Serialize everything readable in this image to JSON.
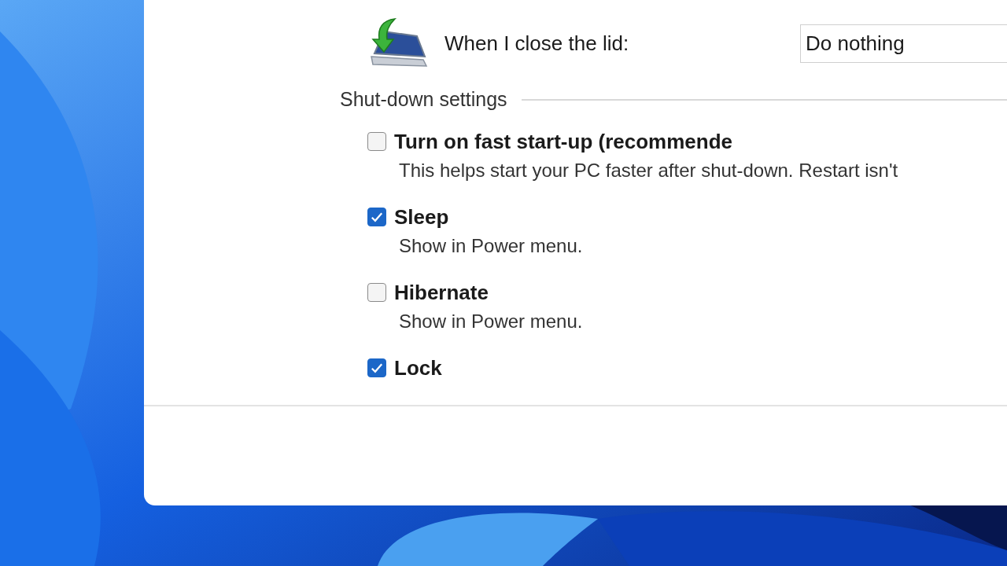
{
  "lid_setting": {
    "label": "When I close the lid:",
    "value": "Do nothing"
  },
  "section_title": "Shut-down settings",
  "options": [
    {
      "label": "Turn on fast start-up (recommende",
      "description": "This helps start your PC faster after shut-down. Restart isn't",
      "checked": false
    },
    {
      "label": "Sleep",
      "description": "Show in Power menu.",
      "checked": true
    },
    {
      "label": "Hibernate",
      "description": "Show in Power menu.",
      "checked": false
    },
    {
      "label": "Lock",
      "checked": true
    }
  ]
}
